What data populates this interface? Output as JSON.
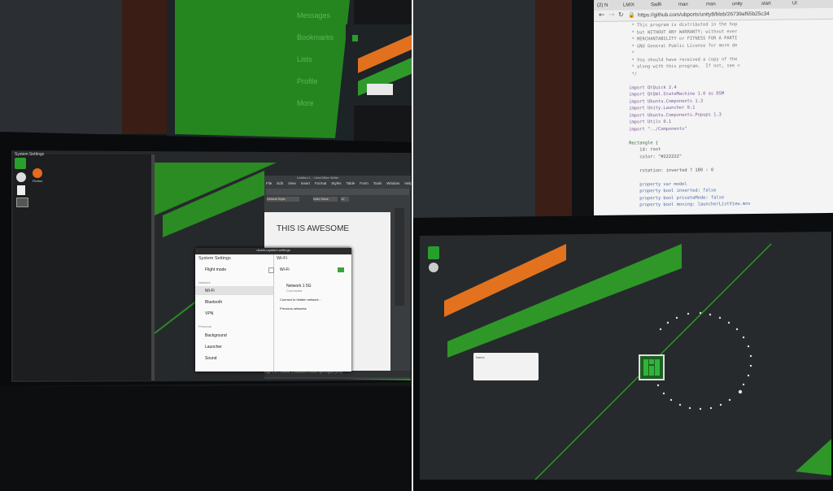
{
  "left_photo": {
    "top_monitor_menu": [
      "Messages",
      "Bookmarks",
      "Lists",
      "Profile",
      "More"
    ],
    "top_left_dock_label": "System Settings",
    "desktop_icon_label": "Firefox",
    "writer": {
      "title_bar": "Untitled 1 - LibreOffice Writer",
      "menu": [
        "File",
        "Edit",
        "View",
        "Insert",
        "Format",
        "Styles",
        "Table",
        "Form",
        "Tools",
        "Window",
        "Help"
      ],
      "style_box": "Default Style",
      "font_box": "Noto Sans",
      "size_box": "12",
      "document_text": "THIS IS AWESOME",
      "status_bar": "Page 1 of 1    0 words, 0 characters    Default Style    English (USA)"
    },
    "settings": {
      "window_title": "ubuntu-system-settings",
      "header": "System Settings",
      "right_header": "Wi-Fi",
      "items": [
        "Wi-Fi",
        "Bluetooth",
        "VPN",
        "Background",
        "Launcher",
        "Sound"
      ],
      "sections": [
        "Network",
        "Personal"
      ],
      "flight_mode": "Flight mode",
      "wifi_label": "Wi-Fi",
      "network_name": "Network 1 5G",
      "network_status": "Connected",
      "connect_hidden": "Connect to hidden network...",
      "previous_networks": "Previous networks"
    }
  },
  "right_photo": {
    "browser": {
      "tabs": [
        "(2) N",
        "LMIX",
        "Sailfi",
        "man",
        "man",
        "unity",
        "start",
        "Ul"
      ],
      "url": "https://github.com/ubports/unity8/blob/26739af65b25c34",
      "code_lines": [
        "  * This program is distributed in the hop",
        "  * but WITHOUT ANY WARRANTY; without ever",
        "  * MERCHANTABILITY or FITNESS FOR A PARTI",
        "  * GNU General Public License for more de",
        "  *",
        "  * You should have received a copy of the",
        "  * along with this program.  If not, see <",
        "  */",
        "",
        " import QtQuick 2.4",
        " import QtQml.StateMachine 1.0 as DSM",
        " import Ubuntu.Components 1.3",
        " import Unity.Launcher 0.1",
        " import Ubuntu.Components.Popups 1.3",
        " import Utils 0.1",
        " import \"../Components\"",
        "",
        " Rectangle {",
        "     id: root",
        "     color: \"#222222\"",
        "",
        "     rotation: inverted ? 180 : 0",
        "",
        "     property var model",
        "     property bool inverted: false",
        "     property bool privateMode: false",
        "     property bool moving: launcherListView.mov"
      ],
      "line_numbers": [
        "",
        "",
        "",
        "",
        "",
        "",
        "",
        "",
        "",
        "",
        "",
        "",
        "",
        "",
        "",
        "",
        "",
        "",
        "",
        "",
        "",
        "",
        "",
        "",
        "",
        "",
        ""
      ]
    },
    "login_box_label": "Name"
  }
}
